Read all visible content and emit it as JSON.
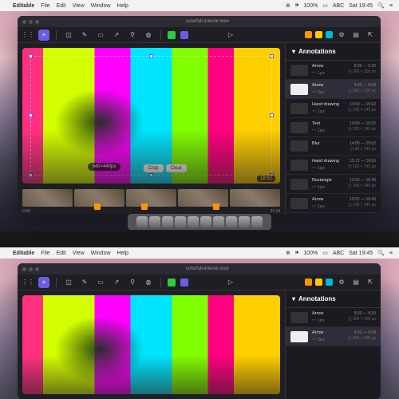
{
  "menubar": {
    "app": "Editable",
    "items": [
      "File",
      "Edit",
      "View",
      "Window",
      "Help"
    ],
    "battery": "100%",
    "input": "ABC",
    "clock": "Sat 19:45"
  },
  "window": {
    "title": "colorfull-interior.mov"
  },
  "toolbar": {
    "play_icon": "▷",
    "swatch_green": "#2ecc40",
    "swatch_purple": "#6c5ce7",
    "right_swatches": [
      "#ff9500",
      "#ffcc00",
      "#00b8d4"
    ]
  },
  "canvas": {
    "size_label": "640×440px",
    "crop_btn": "Crop",
    "clear_btn": "Clear",
    "time_label": "18:52"
  },
  "timeline": {
    "start": "0:00",
    "end": "21:34",
    "clips": 5
  },
  "sidebar": {
    "title": "Annotations",
    "items": [
      {
        "type": "Arrow",
        "stroke": "1px",
        "time": "8:30 — 9:30",
        "size": "300 × 200 px"
      },
      {
        "type": "Arrow",
        "stroke": "2px",
        "time": "9:02 — 9:59",
        "size": "300 × 200 px",
        "selected": true
      },
      {
        "type": "Hand drawing",
        "stroke": "1px",
        "time": "14:00 — 15:02",
        "size": "105 × 145 px"
      },
      {
        "type": "Text",
        "stroke": "1px",
        "time": "14:00 — 15:02",
        "size": "210 × 140 px"
      },
      {
        "type": "Blur",
        "stroke": "",
        "time": "14:00 — 15:02",
        "size": "80 × 145 px"
      },
      {
        "type": "Hand drawing",
        "stroke": "1px",
        "time": "15:12 — 16:00",
        "size": "105 × 145 px"
      },
      {
        "type": "Rectangle",
        "stroke": "1px",
        "time": "15:52 — 16:40",
        "size": "105 × 145 px"
      },
      {
        "type": "Arrow",
        "stroke": "1px",
        "time": "15:52 — 16:40",
        "size": "105 × 145 px"
      }
    ]
  },
  "chart_data": null
}
